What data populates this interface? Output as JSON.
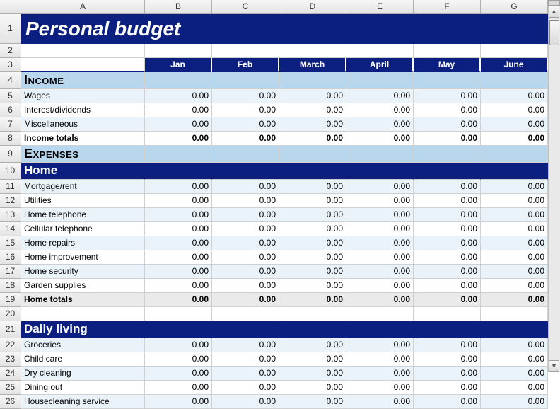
{
  "title": "Personal budget",
  "columns": [
    "",
    "A",
    "B",
    "C",
    "D",
    "E",
    "F",
    "G"
  ],
  "months": [
    "Jan",
    "Feb",
    "March",
    "April",
    "May",
    "June"
  ],
  "sections": {
    "income": {
      "heading": "Income",
      "rows": [
        {
          "label": "Wages",
          "values": [
            "0.00",
            "0.00",
            "0.00",
            "0.00",
            "0.00",
            "0.00"
          ]
        },
        {
          "label": "Interest/dividends",
          "values": [
            "0.00",
            "0.00",
            "0.00",
            "0.00",
            "0.00",
            "0.00"
          ]
        },
        {
          "label": "Miscellaneous",
          "values": [
            "0.00",
            "0.00",
            "0.00",
            "0.00",
            "0.00",
            "0.00"
          ]
        }
      ],
      "total": {
        "label": "Income totals",
        "values": [
          "0.00",
          "0.00",
          "0.00",
          "0.00",
          "0.00",
          "0.00"
        ]
      }
    },
    "expenses_heading": "Expenses",
    "home": {
      "heading": "Home",
      "rows": [
        {
          "label": "Mortgage/rent",
          "values": [
            "0.00",
            "0.00",
            "0.00",
            "0.00",
            "0.00",
            "0.00"
          ]
        },
        {
          "label": "Utilities",
          "values": [
            "0.00",
            "0.00",
            "0.00",
            "0.00",
            "0.00",
            "0.00"
          ]
        },
        {
          "label": "Home telephone",
          "values": [
            "0.00",
            "0.00",
            "0.00",
            "0.00",
            "0.00",
            "0.00"
          ]
        },
        {
          "label": "Cellular telephone",
          "values": [
            "0.00",
            "0.00",
            "0.00",
            "0.00",
            "0.00",
            "0.00"
          ]
        },
        {
          "label": "Home repairs",
          "values": [
            "0.00",
            "0.00",
            "0.00",
            "0.00",
            "0.00",
            "0.00"
          ]
        },
        {
          "label": "Home improvement",
          "values": [
            "0.00",
            "0.00",
            "0.00",
            "0.00",
            "0.00",
            "0.00"
          ]
        },
        {
          "label": "Home security",
          "values": [
            "0.00",
            "0.00",
            "0.00",
            "0.00",
            "0.00",
            "0.00"
          ]
        },
        {
          "label": "Garden supplies",
          "values": [
            "0.00",
            "0.00",
            "0.00",
            "0.00",
            "0.00",
            "0.00"
          ]
        }
      ],
      "total": {
        "label": "Home totals",
        "values": [
          "0.00",
          "0.00",
          "0.00",
          "0.00",
          "0.00",
          "0.00"
        ]
      }
    },
    "daily": {
      "heading": "Daily living",
      "rows": [
        {
          "label": "Groceries",
          "values": [
            "0.00",
            "0.00",
            "0.00",
            "0.00",
            "0.00",
            "0.00"
          ]
        },
        {
          "label": "Child care",
          "values": [
            "0.00",
            "0.00",
            "0.00",
            "0.00",
            "0.00",
            "0.00"
          ]
        },
        {
          "label": "Dry cleaning",
          "values": [
            "0.00",
            "0.00",
            "0.00",
            "0.00",
            "0.00",
            "0.00"
          ]
        },
        {
          "label": "Dining out",
          "values": [
            "0.00",
            "0.00",
            "0.00",
            "0.00",
            "0.00",
            "0.00"
          ]
        },
        {
          "label": "Housecleaning service",
          "values": [
            "0.00",
            "0.00",
            "0.00",
            "0.00",
            "0.00",
            "0.00"
          ]
        }
      ]
    }
  },
  "rownums": [
    "1",
    "2",
    "3",
    "4",
    "5",
    "6",
    "7",
    "8",
    "9",
    "10",
    "11",
    "12",
    "13",
    "14",
    "15",
    "16",
    "17",
    "18",
    "19",
    "20",
    "21",
    "22",
    "23",
    "24",
    "25",
    "26"
  ]
}
